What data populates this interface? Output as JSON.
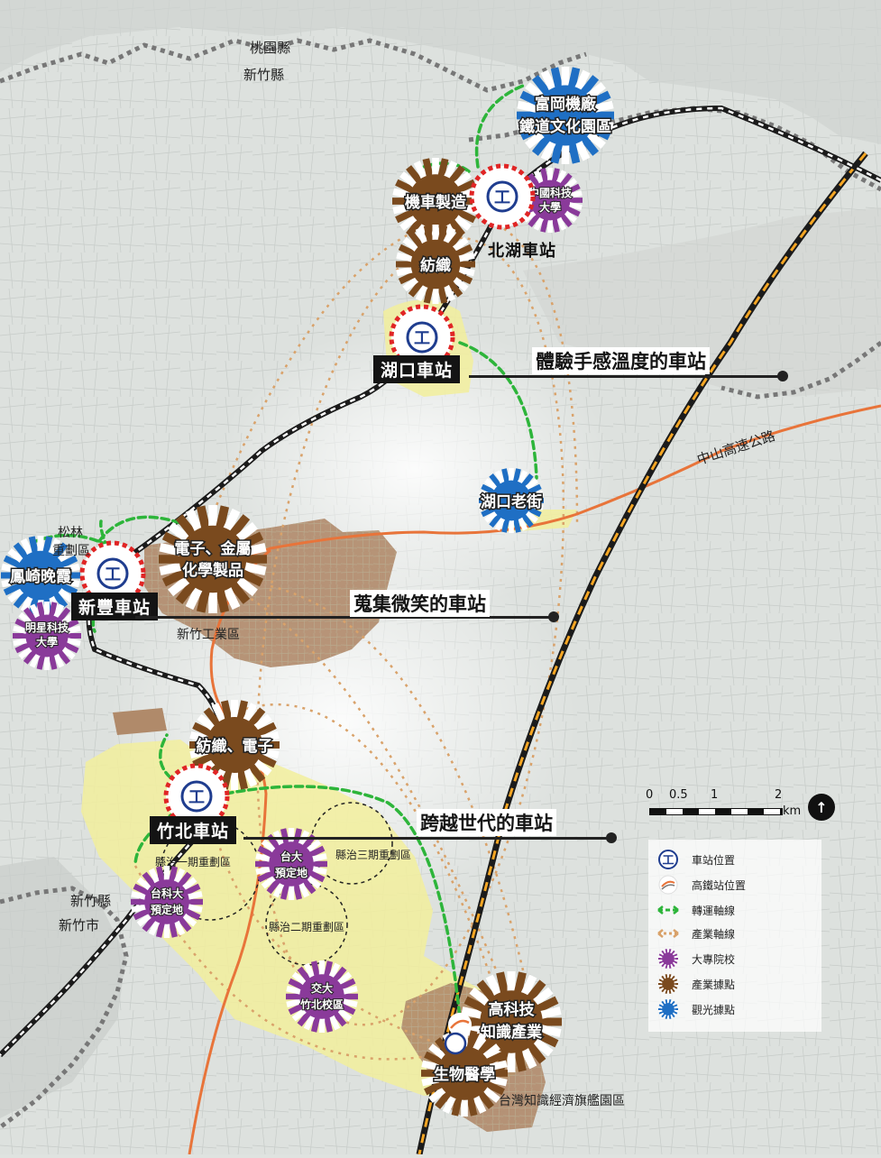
{
  "counties": {
    "taoyuan": "桃園縣",
    "hsinchu_county_top": "新竹縣",
    "hsinchu_county_bottom": "新竹縣",
    "hsinchu_city": "新竹市"
  },
  "stations": {
    "beihu": "北湖車站",
    "hukou": "湖口車站",
    "xinfeng": "新豐車站",
    "zhubei": "竹北車站"
  },
  "slogans": {
    "hukou": "體驗手感溫度的車站",
    "xinfeng": "蒐集微笑的車站",
    "zhubei": "跨越世代的車站"
  },
  "industry_nodes": {
    "motorcycle": "機車製造",
    "textile_beihu": "紡織",
    "electronics_metal_1": "電子、金屬",
    "electronics_metal_2": "化學製品",
    "textile_electronics": "紡織、電子",
    "hightech_1": "高科技",
    "hightech_2": "知識產業",
    "biomed": "生物醫學"
  },
  "tourism_nodes": {
    "fugang_1": "富岡機廠",
    "fugang_2": "鐵道文化園區",
    "hukou_old_street": "湖口老街",
    "fengqi": "鳳崎晚霞"
  },
  "university_nodes": {
    "cust_1": "中國科技",
    "cust_2": "大學",
    "mingshin_1": "明星科技",
    "mingshin_2": "大學",
    "ntu_1": "台大",
    "ntu_2": "預定地",
    "ntust_1": "台科大",
    "ntust_2": "預定地",
    "nctu_1": "交大",
    "nctu_2": "竹北校區"
  },
  "areas": {
    "songlin_1": "松林",
    "songlin_2": "重劃區",
    "hsinchu_industrial": "新竹工業區",
    "phase1": "縣治一期重劃區",
    "phase2": "縣治二期重劃區",
    "phase3": "縣治三期重劃區",
    "flagship": "台灣知識經濟旗艦園區"
  },
  "roads": {
    "zhongshan": "中山高速公路"
  },
  "scale": {
    "ticks": [
      "0",
      "0.5",
      "1",
      "2"
    ],
    "unit": "km"
  },
  "legend": [
    {
      "icon": "tra-station-icon",
      "label": "車站位置"
    },
    {
      "icon": "hsr-station-icon",
      "label": "高鐵站位置"
    },
    {
      "icon": "transfer-axis-icon",
      "label": "轉運軸線"
    },
    {
      "icon": "industry-axis-icon",
      "label": "產業軸線"
    },
    {
      "icon": "university-icon",
      "label": "大專院校"
    },
    {
      "icon": "industry-hub-icon",
      "label": "產業據點"
    },
    {
      "icon": "tourism-hub-icon",
      "label": "觀光據點"
    }
  ],
  "colors": {
    "industry_hub": "#7a4a1e",
    "university": "#8a3a9a",
    "tourism": "#1f6fc4",
    "transfer_axis": "#2db53a",
    "industry_axis": "#d9a26a",
    "highway": "#e8743a",
    "hsr": "#f5a623",
    "yellow_zone": "#f2ef9c",
    "industrial_zone": "#b08a6a"
  }
}
